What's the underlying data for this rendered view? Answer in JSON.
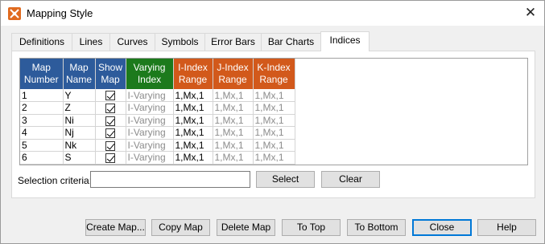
{
  "window": {
    "title": "Mapping Style"
  },
  "tabs": [
    {
      "label": "Definitions"
    },
    {
      "label": "Lines"
    },
    {
      "label": "Curves"
    },
    {
      "label": "Symbols"
    },
    {
      "label": "Error Bars"
    },
    {
      "label": "Bar Charts"
    },
    {
      "label": "Indices"
    }
  ],
  "active_tab": "Indices",
  "table": {
    "headers": [
      {
        "line1": "Map",
        "line2": "Number",
        "color": "#2d5b9b"
      },
      {
        "line1": "Map",
        "line2": "Name",
        "color": "#2d5b9b"
      },
      {
        "line1": "Show",
        "line2": "Map",
        "color": "#2d5b9b"
      },
      {
        "line1": "Varying",
        "line2": "Index",
        "color": "#1c7a1c"
      },
      {
        "line1": "I-Index",
        "line2": "Range",
        "color": "#d2591b"
      },
      {
        "line1": "J-Index",
        "line2": "Range",
        "color": "#d2591b"
      },
      {
        "line1": "K-Index",
        "line2": "Range",
        "color": "#d2591b"
      }
    ],
    "rows": [
      {
        "number": "1",
        "name": "Y",
        "show": true,
        "varying": "I-Varying",
        "i_range": "1,Mx,1",
        "j_range": "1,Mx,1",
        "k_range": "1,Mx,1"
      },
      {
        "number": "2",
        "name": "Z",
        "show": true,
        "varying": "I-Varying",
        "i_range": "1,Mx,1",
        "j_range": "1,Mx,1",
        "k_range": "1,Mx,1"
      },
      {
        "number": "3",
        "name": "Ni",
        "show": true,
        "varying": "I-Varying",
        "i_range": "1,Mx,1",
        "j_range": "1,Mx,1",
        "k_range": "1,Mx,1"
      },
      {
        "number": "4",
        "name": "Nj",
        "show": true,
        "varying": "I-Varying",
        "i_range": "1,Mx,1",
        "j_range": "1,Mx,1",
        "k_range": "1,Mx,1"
      },
      {
        "number": "5",
        "name": "Nk",
        "show": true,
        "varying": "I-Varying",
        "i_range": "1,Mx,1",
        "j_range": "1,Mx,1",
        "k_range": "1,Mx,1"
      },
      {
        "number": "6",
        "name": "S",
        "show": true,
        "varying": "I-Varying",
        "i_range": "1,Mx,1",
        "j_range": "1,Mx,1",
        "k_range": "1,Mx,1"
      }
    ]
  },
  "selection": {
    "label": "Selection criteria:",
    "value": "",
    "select_label": "Select",
    "clear_label": "Clear"
  },
  "footer": {
    "create_map": "Create Map...",
    "copy_map": "Copy Map",
    "delete_map": "Delete Map",
    "to_top": "To Top",
    "to_bottom": "To Bottom",
    "close": "Close",
    "help": "Help"
  },
  "icons": {
    "app": "mapping-style-icon",
    "close": "close-icon",
    "checkbox": "checkbox-checked-icon"
  },
  "colors": {
    "header_blue": "#2d5b9b",
    "header_green": "#1c7a1c",
    "header_orange": "#d2591b",
    "app_icon": "#e06a1f"
  }
}
